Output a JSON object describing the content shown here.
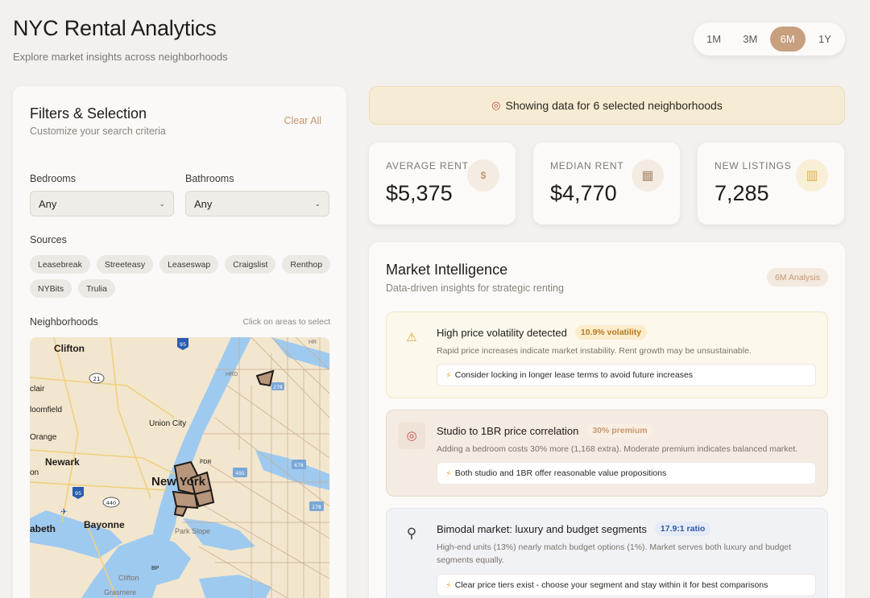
{
  "header": {
    "title": "NYC Rental Analytics",
    "subtitle": "Explore market insights across neighborhoods"
  },
  "time_range": {
    "options": [
      "1M",
      "3M",
      "6M",
      "1Y"
    ],
    "selected": "6M"
  },
  "filters": {
    "title": "Filters & Selection",
    "subtitle": "Customize your search criteria",
    "clear_label": "Clear All",
    "bedrooms_label": "Bedrooms",
    "bedrooms_value": "Any",
    "bathrooms_label": "Bathrooms",
    "bathrooms_value": "Any",
    "sources_label": "Sources",
    "sources": [
      "Leasebreak",
      "Streeteasy",
      "Leaseswap",
      "Craigslist",
      "Renthop",
      "NYBits",
      "Trulia"
    ],
    "neighborhoods_label": "Neighborhoods",
    "neighborhoods_hint": "Click on areas to select"
  },
  "map": {
    "labels": {
      "clifton_top": "Clifton",
      "clair": "clair",
      "bloomfield": "loomfield",
      "orange": "Orange",
      "newark": "Newark",
      "on": "on",
      "union_city": "Union City",
      "new_york": "New York",
      "bayonne": "Bayonne",
      "elizabeth": "abeth",
      "park_slope": "Park Slope",
      "clifton_bottom": "Clifton",
      "grasmere": "Grasmere",
      "hr": "HR",
      "hrd": "HRD",
      "fdr": "FDR",
      "bp": "BP"
    },
    "shields": {
      "i95_top": "95",
      "r21": "21",
      "i278": "278",
      "i495": "495",
      "r678": "678",
      "i95_bottom": "95",
      "r440": "440",
      "r278b": "278"
    },
    "colors": {
      "water": "#9fcaf0",
      "land": "#f2e6cf",
      "selected": "#b8967c",
      "boundary": "#c9a98b"
    }
  },
  "banner": {
    "icon": "target-icon",
    "text": "Showing data for 6 selected neighborhoods"
  },
  "stats": [
    {
      "label": "AVERAGE RENT",
      "value": "$5,375",
      "icon": "dollar-icon",
      "icon_glyph": "$",
      "icon_bg": "#f4ece2",
      "icon_color": "#c9976d"
    },
    {
      "label": "MEDIAN RENT",
      "value": "$4,770",
      "icon": "calculator-icon",
      "icon_glyph": "▦",
      "icon_bg": "#f4ece2",
      "icon_color": "#a88d75"
    },
    {
      "label": "NEW LISTINGS",
      "value": "7,285",
      "icon": "building-icon",
      "icon_glyph": "▥",
      "icon_bg": "#f8efd6",
      "icon_color": "#dfb24a"
    }
  ],
  "intel": {
    "title": "Market Intelligence",
    "subtitle": "Data-driven insights for strategic renting",
    "badge": "6M Analysis",
    "insights": [
      {
        "icon": "warning-icon",
        "icon_glyph": "⚠",
        "heading": "High price volatility detected",
        "tag": "10.9% volatility",
        "description": "Rapid price increases indicate market instability. Rent growth may be unsustainable.",
        "tip": "Consider locking in longer lease terms to avoid future increases"
      },
      {
        "icon": "target-icon",
        "icon_glyph": "◎",
        "heading": "Studio to 1BR price correlation",
        "tag": "30% premium",
        "description": "Adding a bedroom costs 30% more (1,168 extra). Moderate premium indicates balanced market.",
        "tip": "Both studio and 1BR offer reasonable value propositions"
      },
      {
        "icon": "magnifier-icon",
        "icon_glyph": "⚲",
        "heading": "Bimodal market: luxury and budget segments",
        "tag": "17.9:1 ratio",
        "description": "High-end units (13%) nearly match budget options (1%). Market serves both luxury and budget segments equally.",
        "tip": "Clear price tiers exist - choose your segment and stay within it for best comparisons"
      }
    ]
  }
}
